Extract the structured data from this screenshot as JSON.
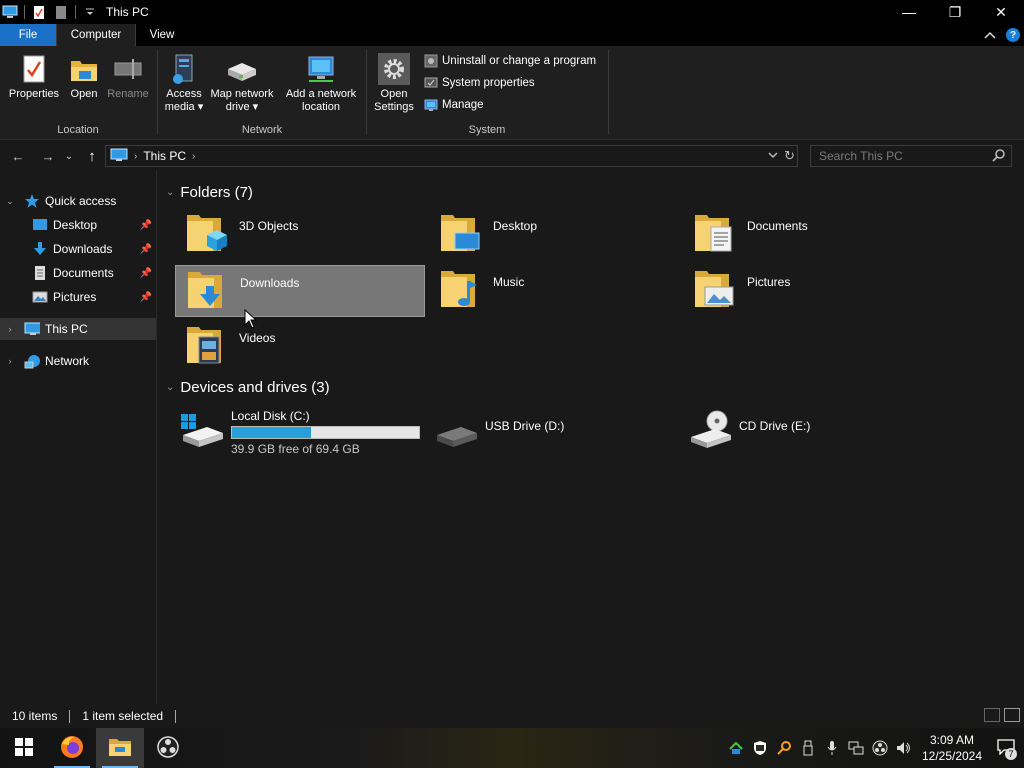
{
  "window": {
    "title": "This PC",
    "minimize": "—",
    "restore": "❐",
    "close": "✕"
  },
  "ribbon": {
    "tabs": [
      "File",
      "Computer",
      "View"
    ],
    "active_tab": "Computer",
    "groups": {
      "location": {
        "label": "Location",
        "buttons": [
          "Properties",
          "Open",
          "Rename"
        ]
      },
      "network": {
        "label": "Network",
        "access_media": [
          "Access",
          "media ▾"
        ],
        "map_drive": [
          "Map network",
          "drive ▾"
        ],
        "add_location": [
          "Add a network",
          "location"
        ]
      },
      "system": {
        "label": "System",
        "open_settings": [
          "Open",
          "Settings"
        ],
        "uninstall": "Uninstall or change a program",
        "system_properties": "System properties",
        "manage": "Manage"
      }
    },
    "collapse_icon": "chevron-up-icon",
    "help": "?"
  },
  "navigation": {
    "back_icon": "←",
    "forward_icon": "→",
    "recent_icon": "⌄",
    "up_icon": "↑",
    "address": "This PC",
    "refresh_icon": "↻",
    "search_placeholder": "Search This PC"
  },
  "nav_pane": {
    "quick_access": "Quick access",
    "quick_items": [
      "Desktop",
      "Downloads",
      "Documents",
      "Pictures"
    ],
    "this_pc": "This PC",
    "network": "Network"
  },
  "content": {
    "folders_header": "Folders (7)",
    "folders": [
      "3D Objects",
      "Desktop",
      "Documents",
      "Downloads",
      "Music",
      "Pictures",
      "Videos"
    ],
    "selected_folder": "Downloads",
    "drives_header": "Devices and drives (3)",
    "drives": [
      {
        "name": "Local Disk (C:)",
        "free": "39.9 GB free of 69.4 GB",
        "used_fraction": 0.425
      },
      {
        "name": "USB Drive (D:)"
      },
      {
        "name": "CD Drive (E:)"
      }
    ]
  },
  "status": {
    "items": "10 items",
    "selected": "1 item selected"
  },
  "taskbar": {
    "apps": [
      "start-icon",
      "firefox-icon",
      "file-explorer-icon",
      "obs-icon"
    ],
    "time": "3:09 AM",
    "date": "12/25/2024",
    "notifications": "7"
  },
  "colors": {
    "accent": "#1a6fc7",
    "folder": "#f4c95d",
    "progress": "#26a0da",
    "selection": "#777777"
  }
}
